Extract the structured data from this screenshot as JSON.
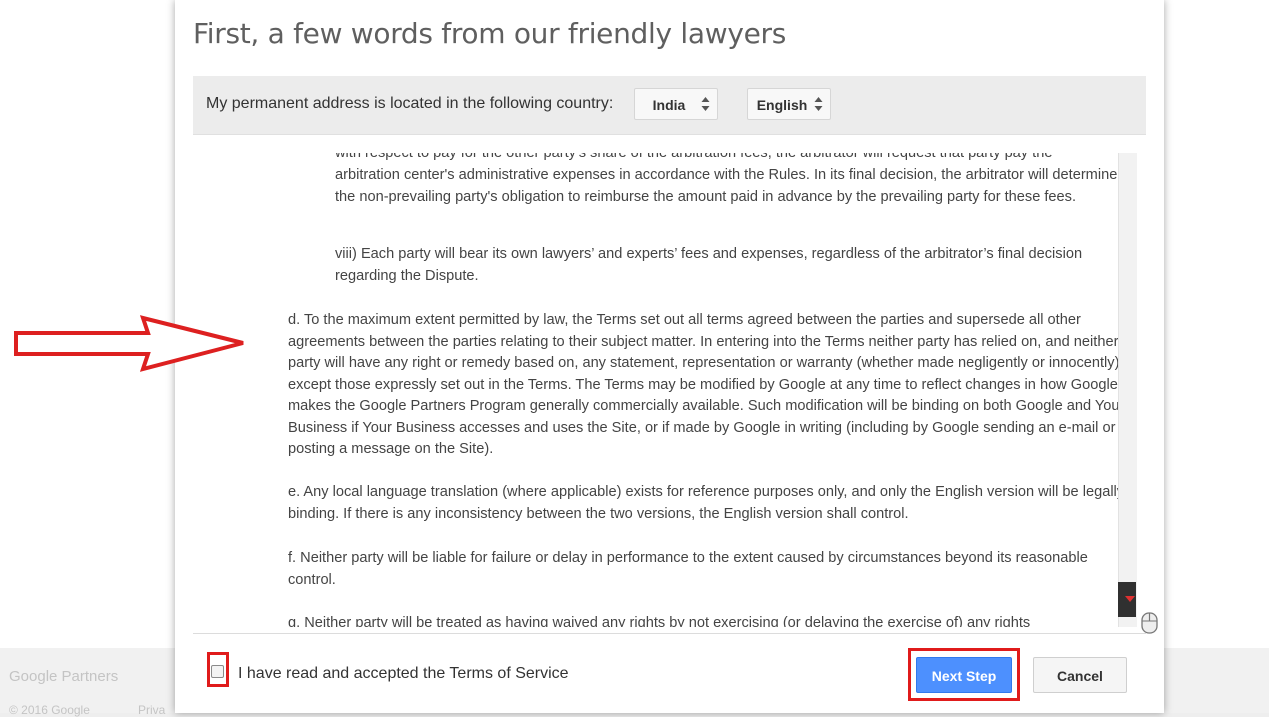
{
  "background": {
    "brand": "Google Partners",
    "copyright": "© 2016 Google",
    "privacy": "Priva"
  },
  "dialog": {
    "title": "First, a few words from our friendly lawyers",
    "country_bar": {
      "label": "My permanent address is located in the following country:",
      "country": "India",
      "language": "English"
    },
    "terms": {
      "cut_line": "with respect to pay for the other party's share of the arbitration fees, the arbitrator will request that party pay the",
      "fees": "arbitration center's administrative expenses in accordance with the Rules. In its final decision, the arbitrator will determine the non-prevailing party's obligation to reimburse the amount paid in advance by the prevailing party for these fees.",
      "viii": "viii) Each party will bear its own lawyers’ and experts’ fees and expenses, regardless of the arbitrator’s final decision regarding the Dispute.",
      "d": "d. To the maximum extent permitted by law, the Terms set out all terms agreed between the parties and supersede all other agreements between the parties relating to their subject matter. In entering into the Terms neither party has relied on, and neither party will have any right or remedy based on, any statement, representation or warranty (whether made negligently or innocently), except those expressly set out in the Terms. The Terms may be modified by Google at any time to reflect changes in how Google makes the Google Partners Program generally commercially available. Such modification will be binding on both Google and Your Business if Your Business accesses and uses the Site, or if made by Google in writing (including by Google sending an e-mail or posting a message on the Site).",
      "e": "e. Any local language translation (where applicable) exists for reference purposes only, and only the English version will be legally binding. If there is any inconsistency between the two versions, the English version shall control.",
      "f": "f. Neither party will be liable for failure or delay in performance to the extent caused by circumstances beyond its reasonable control.",
      "g": "g. Neither party will be treated as having waived any rights by not exercising (or delaying the exercise of) any rights"
    },
    "accept_label": "I have read and accepted the Terms of Service",
    "accept_checked": false,
    "next_label": "Next Step",
    "cancel_label": "Cancel"
  },
  "colors": {
    "primary_button": "#4d90fe",
    "highlight": "#e01b1b"
  }
}
